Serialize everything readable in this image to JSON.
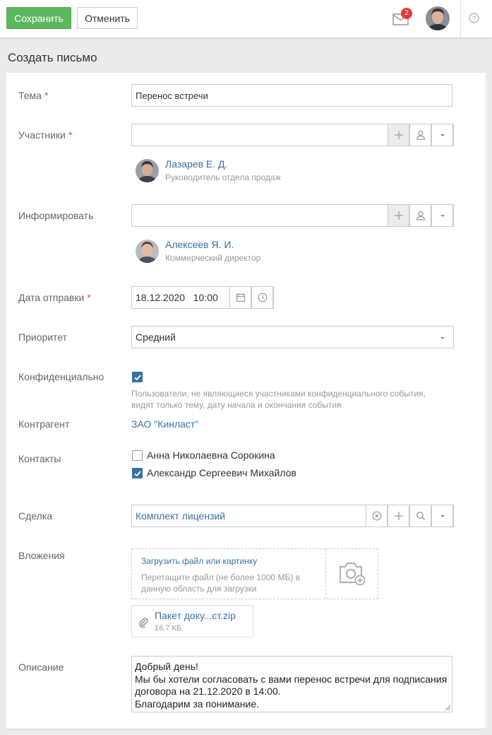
{
  "toolbar": {
    "save_label": "Сохранить",
    "cancel_label": "Отменить",
    "mail_badge_count": "2"
  },
  "page_title": "Создать письмо",
  "form": {
    "subject": {
      "label": "Тема",
      "required_mark": "*",
      "value": "Перенос встречи"
    },
    "participants": {
      "label": "Участники",
      "required_mark": "*",
      "value": "",
      "person": {
        "name": "Лазарев Е. Д.",
        "role": "Руководитель отдела продаж"
      }
    },
    "inform": {
      "label": "Информировать",
      "value": "",
      "person": {
        "name": "Алексеев Я. И.",
        "role": "Коммерческий директор"
      }
    },
    "send_date": {
      "label": "Дата отправки",
      "required_mark": "*",
      "value": "18.12.2020   10:00"
    },
    "priority": {
      "label": "Приоритет",
      "value": "Средний"
    },
    "confidential": {
      "label": "Конфиденциально",
      "checked": true,
      "hint_line1": "Пользователи, не являющиеся участниками конфиденциального события,",
      "hint_line2": "видят только тему, дату начала и окончания события"
    },
    "counterparty": {
      "label": "Контрагент",
      "value": "ЗАО \"Кинласт\""
    },
    "contacts": {
      "label": "Контакты",
      "items": [
        {
          "name": "Анна Николаевна Сорокина",
          "checked": false
        },
        {
          "name": "Александр Сергеевич Михайлов",
          "checked": true
        }
      ]
    },
    "deal": {
      "label": "Сделка",
      "value": "Комплект лицензий"
    },
    "attachments": {
      "label": "Вложения",
      "upload_link": "Загрузить файл или картинку",
      "upload_hint": "Перетащите файл (не более 1000 МБ) в данную область для загрузки",
      "file": {
        "name": "Пакет доку...ст.zip",
        "size": "16.7 КБ"
      }
    },
    "description": {
      "label": "Описание",
      "lines": [
        "Добрый день!",
        "Мы бы хотели согласовать с вами перенос встречи для подписания",
        "договора на 21.12.2020 в 14:00.",
        "Благодарим за понимание."
      ]
    }
  },
  "colors": {
    "accent": "#3a70a7",
    "save": "#5cb85c",
    "required": "#d9534f",
    "badge": "#e53935"
  }
}
